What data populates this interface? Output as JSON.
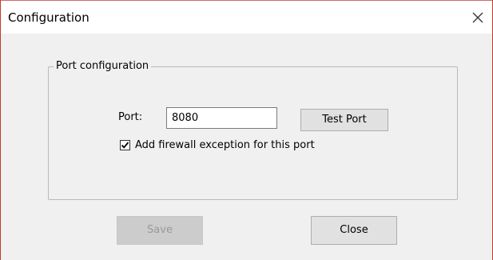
{
  "window": {
    "title": "Configuration"
  },
  "group": {
    "legend": "Port configuration"
  },
  "port": {
    "label": "Port:",
    "value": "8080",
    "test_button_label": "Test Port"
  },
  "firewall": {
    "checked": true,
    "label": "Add firewall exception for this port"
  },
  "footer": {
    "save_label": "Save",
    "save_enabled": false,
    "close_label": "Close"
  },
  "icons": {
    "close": "close-icon",
    "check": "checkmark-icon"
  },
  "colors": {
    "dialog_background": "#f0f0f0",
    "window_border": "#c0392b",
    "disabled_text": "#9a9a9a"
  }
}
